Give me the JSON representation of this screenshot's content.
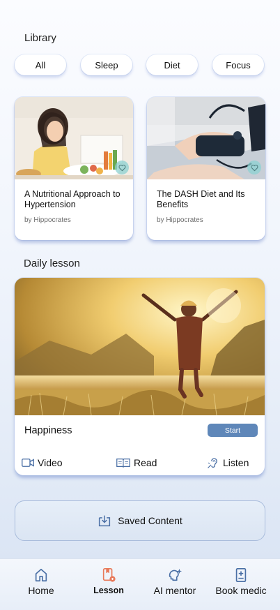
{
  "library": {
    "title": "Library",
    "chips": [
      "All",
      "Sleep",
      "Diet",
      "Focus"
    ],
    "cards": [
      {
        "title": "A Nutritional Approach to Hypertension",
        "author": "by Hippocrates"
      },
      {
        "title": "The DASH Diet and Its Benefits",
        "author": "by Hippocrates"
      }
    ]
  },
  "daily": {
    "title": "Daily lesson",
    "name": "Happiness",
    "start_label": "Start",
    "options": [
      {
        "label": "Video",
        "icon": "video-icon"
      },
      {
        "label": "Read",
        "icon": "book-icon"
      },
      {
        "label": "Listen",
        "icon": "hearing-icon"
      }
    ]
  },
  "saved": {
    "label": "Saved Content",
    "icon": "download-box-icon"
  },
  "nav": {
    "items": [
      {
        "label": "Home",
        "icon": "home-icon",
        "active": false
      },
      {
        "label": "Lesson",
        "icon": "lesson-icon",
        "active": true
      },
      {
        "label": "AI mentor",
        "icon": "ai-mentor-icon",
        "active": false
      },
      {
        "label": "Book medic",
        "icon": "book-medic-icon",
        "active": false
      }
    ]
  },
  "colors": {
    "accent": "#5f87b9",
    "active_nav": "#e8795a",
    "icon_blue": "#4a6fa5"
  }
}
